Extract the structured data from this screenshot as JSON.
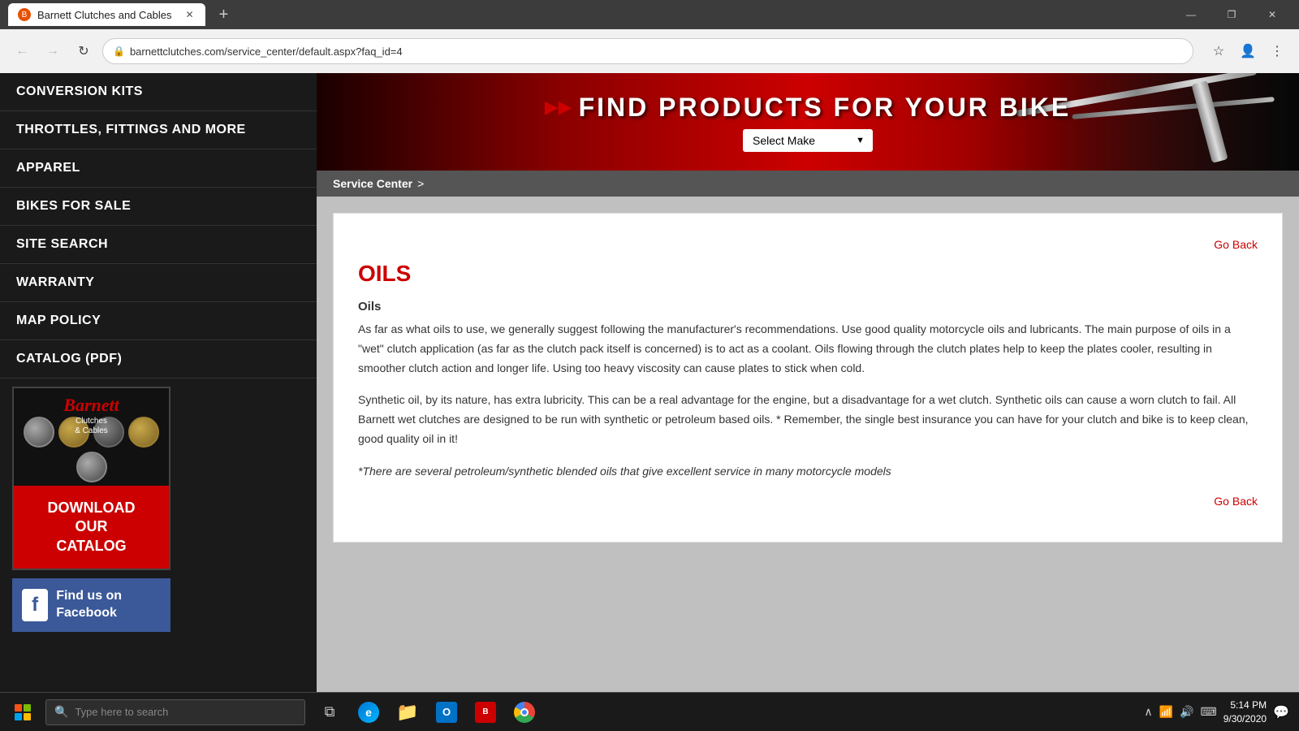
{
  "browser": {
    "tab": {
      "title": "Barnett Clutches and Cables",
      "favicon": "🔧"
    },
    "url": "barnettclutches.com/service_center/default.aspx?faq_id=4",
    "new_tab_label": "+",
    "minimize": "—",
    "maximize": "❐",
    "close": "✕"
  },
  "nav": {
    "back": "←",
    "forward": "→",
    "refresh": "↻",
    "lock": "🔒"
  },
  "sidebar": {
    "items": [
      {
        "label": "CONVERSION KITS"
      },
      {
        "label": "THROTTLES, FITTINGS AND MORE"
      },
      {
        "label": "APPAREL"
      },
      {
        "label": "BIKES FOR SALE"
      },
      {
        "label": "SITE SEARCH"
      },
      {
        "label": "WARRANTY"
      },
      {
        "label": "MAP POLICY"
      },
      {
        "label": "CATALOG (PDF)"
      }
    ],
    "catalog": {
      "download_label": "DOWNLOAD\nOUR\nCATALOG"
    },
    "facebook": {
      "text": "Find us on Facebook"
    }
  },
  "hero": {
    "title": "FIND PRODUCTS FOR YOUR BIKE",
    "select_placeholder": "Select Make"
  },
  "breadcrumb": {
    "label": "Service Center",
    "separator": ">"
  },
  "article": {
    "title": "OILS",
    "subtitle": "Oils",
    "go_back": "Go Back",
    "paragraph1": "As far as what oils to use, we generally suggest following the manufacturer's recommendations. Use good quality motorcycle oils and lubricants. The main purpose of oils in a \"wet\" clutch application (as far as the clutch pack itself is concerned) is to act as a coolant. Oils flowing through the clutch plates help to keep the plates cooler, resulting in smoother clutch action and longer life. Using too heavy viscosity can cause plates to stick when cold.",
    "paragraph2": "Synthetic oil, by its nature, has extra lubricity. This can be a real advantage for the engine, but a disadvantage for a wet clutch. Synthetic oils can cause a worn clutch to fail. All Barnett wet clutches are designed to be run with synthetic or petroleum based oils. * Remember, the single best insurance you can have for your clutch and bike is to keep clean, good quality oil in it!",
    "paragraph3": "*There are several petroleum/synthetic blended oils that give excellent service in many motorcycle models"
  },
  "taskbar": {
    "search_placeholder": "Type here to search",
    "time": "5:14 PM",
    "date": "9/30/2020"
  }
}
